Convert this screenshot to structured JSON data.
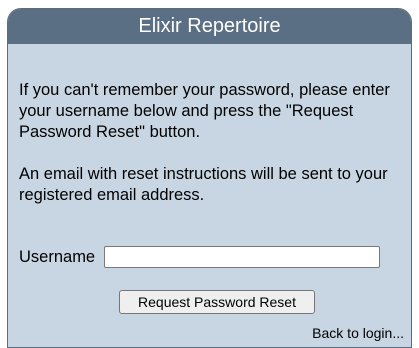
{
  "header": {
    "title": "Elixir Repertoire"
  },
  "instructions": {
    "paragraph1": "If you can't remember your password, please enter your username below and press the \"Request Password Reset\" button.",
    "paragraph2": "An email with reset instructions will be sent to your registered email address."
  },
  "form": {
    "username_label": "Username",
    "username_value": "",
    "submit_label": "Request Password Reset",
    "back_link": "Back to login..."
  },
  "colors": {
    "panel_background": "#c8d6e3",
    "title_background": "#5b6f84",
    "title_text": "#ffffff"
  }
}
